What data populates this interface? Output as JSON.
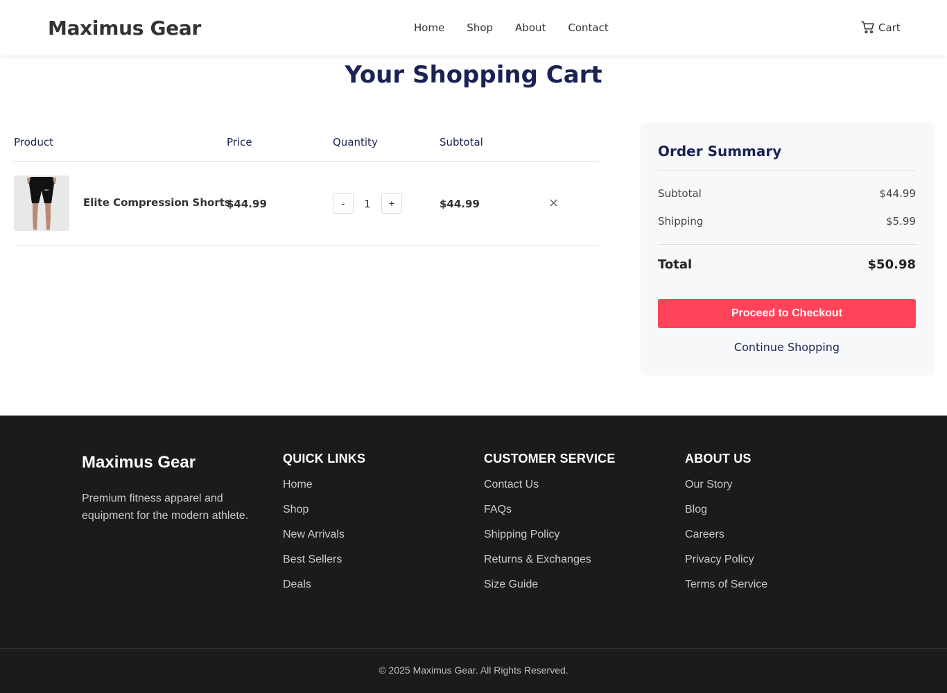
{
  "header": {
    "logo": "Maximus Gear",
    "nav": [
      "Home",
      "Shop",
      "About",
      "Contact"
    ],
    "cart_label": "Cart"
  },
  "page_title": "Your Shopping Cart",
  "cart": {
    "columns": [
      "Product",
      "Price",
      "Quantity",
      "Subtotal"
    ],
    "items": [
      {
        "name": "Elite Compression Shorts",
        "price": "$44.99",
        "quantity": "1",
        "subtotal": "$44.99",
        "remove_symbol": "×",
        "minus_label": "-",
        "plus_label": "+"
      }
    ]
  },
  "summary": {
    "title": "Order Summary",
    "subtotal_label": "Subtotal",
    "subtotal_value": "$44.99",
    "shipping_label": "Shipping",
    "shipping_value": "$5.99",
    "total_label": "Total",
    "total_value": "$50.98",
    "checkout_label": "Proceed to Checkout",
    "continue_label": "Continue Shopping"
  },
  "footer": {
    "brand": "Maximus Gear",
    "description": "Premium fitness apparel and equipment for the modern athlete.",
    "quick_links": {
      "title": "QUICK LINKS",
      "links": [
        "Home",
        "Shop",
        "New Arrivals",
        "Best Sellers",
        "Deals"
      ]
    },
    "customer_service": {
      "title": "CUSTOMER SERVICE",
      "links": [
        "Contact Us",
        "FAQs",
        "Shipping Policy",
        "Returns & Exchanges",
        "Size Guide"
      ]
    },
    "about_us": {
      "title": "ABOUT US",
      "links": [
        "Our Story",
        "Blog",
        "Careers",
        "Privacy Policy",
        "Terms of Service"
      ]
    },
    "copyright": "© 2025 Maximus Gear. All Rights Reserved."
  },
  "colors": {
    "accent": "#ff4459",
    "navy": "#1b2354",
    "footer_bg": "#1b1b1b"
  },
  "icons": {
    "cart": "shopping-cart-icon",
    "remove": "close-icon"
  }
}
